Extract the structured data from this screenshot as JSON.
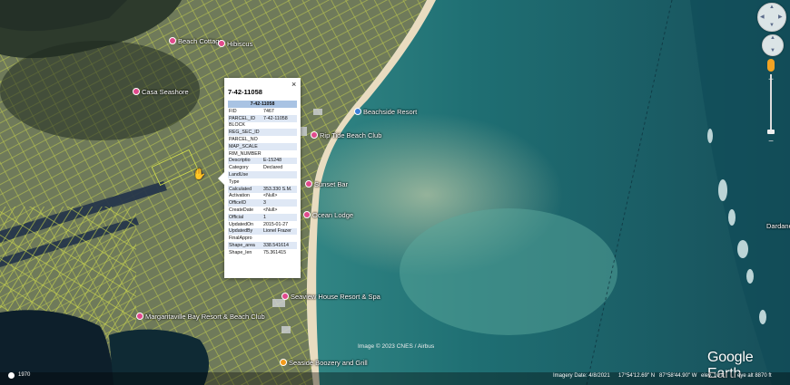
{
  "map": {
    "places": [
      {
        "name": "Beach Cottage",
        "pin": "pink"
      },
      {
        "name": "Hibiscus",
        "pin": "pink"
      },
      {
        "name": "Casa Seashore",
        "pin": "pink"
      },
      {
        "name": "Beachside Resort",
        "pin": "blue"
      },
      {
        "name": "Rip Tide Beach Club",
        "pin": "pink"
      },
      {
        "name": "Sunset Bar",
        "pin": "pink"
      },
      {
        "name": "Ocean Lodge",
        "pin": "pink"
      },
      {
        "name": "Seaview House Resort & Spa",
        "pin": "pink"
      },
      {
        "name": "Margaritaville Bay Resort & Beach Club",
        "pin": "pink"
      },
      {
        "name": "Seaside Boozery and Grill",
        "pin": "orange"
      },
      {
        "name": "Dardanelle",
        "pin": "none"
      }
    ],
    "attribution": "Image © 2023 CNES / Airbus",
    "logo": "Google Earth"
  },
  "popup": {
    "title": "7-42-11058",
    "header": "7-42-11058",
    "close_label": "×",
    "rows": [
      {
        "key": "FID",
        "value": "7467"
      },
      {
        "key": "PARCEL_ID",
        "value": "7-42-11058"
      },
      {
        "key": "BLOCK",
        "value": ""
      },
      {
        "key": "REG_SEC_ID",
        "value": ""
      },
      {
        "key": "PARCEL_NO",
        "value": ""
      },
      {
        "key": "MAP_SCALE",
        "value": ""
      },
      {
        "key": "RIM_NUMBER",
        "value": ""
      },
      {
        "key": "Descriptio",
        "value": "E-15248"
      },
      {
        "key": "Category",
        "value": "Declared"
      },
      {
        "key": "LandUse",
        "value": ""
      },
      {
        "key": "Type",
        "value": ""
      },
      {
        "key": "Calculated",
        "value": "353.330 S.M."
      },
      {
        "key": "Activation",
        "value": "<Null>"
      },
      {
        "key": "OfficeID",
        "value": "3"
      },
      {
        "key": "CreateDate",
        "value": "<Null>"
      },
      {
        "key": "Official",
        "value": "1"
      },
      {
        "key": "UpdatedOn",
        "value": "2015-01-27"
      },
      {
        "key": "UpdatedBy",
        "value": "Lionel Frazer"
      },
      {
        "key": "FinalAppro",
        "value": ""
      },
      {
        "key": "Shape_area",
        "value": "338.541614"
      },
      {
        "key": "Shape_len",
        "value": "75.361415"
      }
    ]
  },
  "footer": {
    "scale_year": "1970",
    "imagery_date": "Imagery Date: 4/8/2021",
    "lat": "17°54'12.69\" N",
    "lon": "87°58'44.90\" W",
    "elev": "elev.  10 ft",
    "eye_alt": "eye alt  8870 ft"
  },
  "colors": {
    "popup_header": "#a9c3e3",
    "popup_row_alt": "#dfe8f5",
    "parcel_lines": "#d7e34a"
  }
}
